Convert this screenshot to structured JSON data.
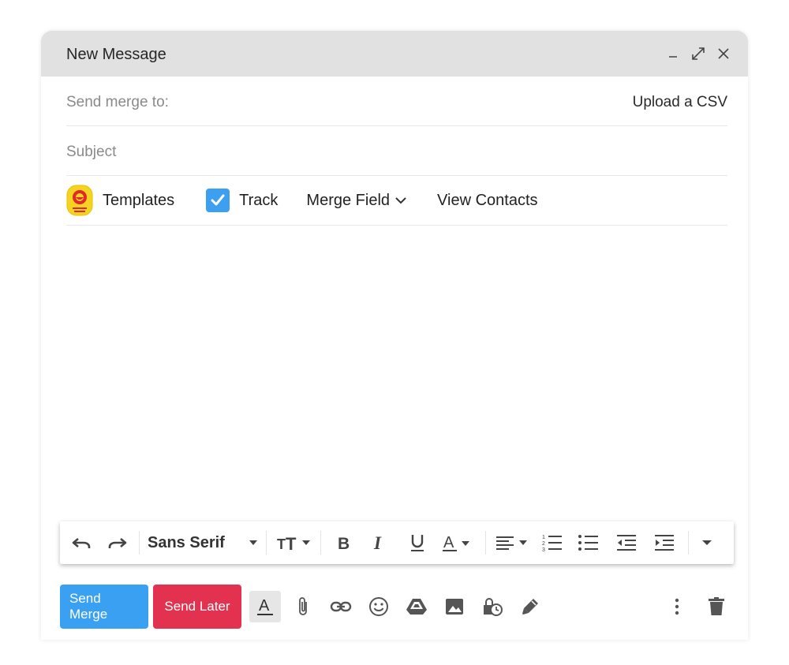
{
  "window": {
    "title": "New Message",
    "controls": [
      "minimize-icon",
      "expand-icon",
      "close-icon"
    ]
  },
  "recipients": {
    "placeholder": "Send merge to:",
    "upload_label": "Upload a CSV"
  },
  "subject": {
    "placeholder": "Subject"
  },
  "tools": {
    "templates_label": "Templates",
    "track_label": "Track",
    "track_checked": true,
    "merge_field_label": "Merge Field",
    "view_contacts_label": "View Contacts"
  },
  "formatting": {
    "font": "Sans Serif",
    "icons": [
      "undo-icon",
      "redo-icon",
      "font-select-dropdown",
      "text-size-icon",
      "bold-icon",
      "italic-icon",
      "underline-icon",
      "text-color-icon",
      "align-icon",
      "numbered-list-icon",
      "bulleted-list-icon",
      "indent-less-icon",
      "indent-more-icon",
      "more-formatting-icon"
    ]
  },
  "actions": {
    "send_merge_label": "Send Merge",
    "send_later_label": "Send Later",
    "icons": [
      "formatting-options-icon",
      "attach-icon",
      "link-icon",
      "emoji-icon",
      "drive-icon",
      "photo-icon",
      "confidential-mode-icon",
      "signature-icon",
      "more-options-icon",
      "trash-icon"
    ]
  },
  "colors": {
    "header_bg": "#e1e1e1",
    "primary": "#3aa1f2",
    "danger": "#e2324f",
    "checkbox": "#3d9ff0"
  }
}
